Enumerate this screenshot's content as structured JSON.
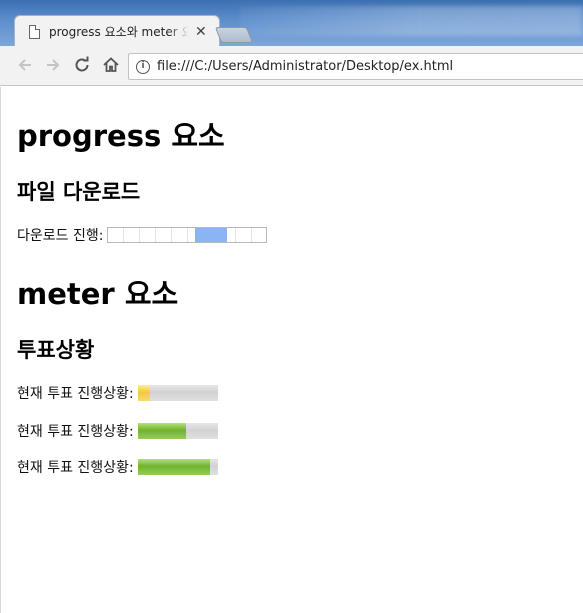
{
  "browser": {
    "tab_title": "progress 요소와 meter 요소",
    "tab_close": "✕",
    "url": "file:///C:/Users/Administrator/Desktop/ex.html"
  },
  "page": {
    "progress_heading": "progress 요소",
    "download_heading": "파일 다운로드",
    "download_label": "다운로드 진행:",
    "download_progress": {
      "state": "indeterminate",
      "indicator_start": 0.55,
      "indicator_end": 0.75
    },
    "meter_heading": "meter 요소",
    "vote_heading": "투표상황",
    "votes": [
      {
        "label": "현재 투표 진행상황:",
        "value": 0.15,
        "state": "low",
        "color": "#f3c83c"
      },
      {
        "label": "현재 투표 진행상황:",
        "value": 0.6,
        "state": "optimum",
        "color": "#6fb32e"
      },
      {
        "label": "현재 투표 진행상황:",
        "value": 0.9,
        "state": "optimum",
        "color": "#6fb32e"
      }
    ]
  }
}
